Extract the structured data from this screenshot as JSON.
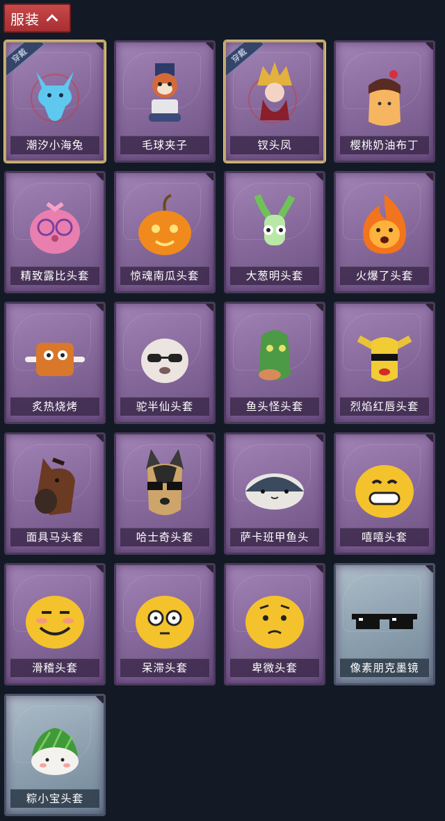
{
  "header": {
    "title": "服装"
  },
  "items": [
    {
      "name": "潮汐小海兔",
      "equipped": true,
      "equipped_label": "穿戴",
      "icon": "blue-bunny-icon"
    },
    {
      "name": "毛球夹子",
      "equipped": false,
      "icon": "raccoon-drummer-icon"
    },
    {
      "name": "钗头凤",
      "equipped": true,
      "equipped_label": "穿戴",
      "icon": "phoenix-headdress-icon"
    },
    {
      "name": "樱桃奶油布丁",
      "equipped": false,
      "icon": "pudding-icon"
    },
    {
      "name": "精致露比头套",
      "equipped": false,
      "icon": "pink-glasses-mask-icon"
    },
    {
      "name": "惊魂南瓜头套",
      "equipped": false,
      "icon": "pumpkin-icon"
    },
    {
      "name": "大葱明头套",
      "equipped": false,
      "icon": "scallion-mask-icon"
    },
    {
      "name": "火爆了头套",
      "equipped": false,
      "icon": "fire-mask-icon"
    },
    {
      "name": "炙热烧烤",
      "equipped": false,
      "icon": "bbq-meat-icon"
    },
    {
      "name": "驼半仙头套",
      "equipped": false,
      "icon": "alpaca-sunglasses-icon"
    },
    {
      "name": "鱼头怪头套",
      "equipped": false,
      "icon": "fish-head-icon"
    },
    {
      "name": "烈焰红唇头套",
      "equipped": false,
      "icon": "yellow-sunglasses-mask-icon"
    },
    {
      "name": "面具马头套",
      "equipped": false,
      "icon": "horse-mask-icon"
    },
    {
      "name": "哈士奇头套",
      "equipped": false,
      "icon": "husky-sunglasses-icon"
    },
    {
      "name": "萨卡班甲鱼头",
      "equipped": false,
      "icon": "sacabambaspis-icon"
    },
    {
      "name": "嘻嘻头套",
      "equipped": false,
      "icon": "grin-emoji-icon"
    },
    {
      "name": "滑稽头套",
      "equipped": false,
      "icon": "smirk-emoji-icon"
    },
    {
      "name": "呆滞头套",
      "equipped": false,
      "icon": "blank-stare-emoji-icon"
    },
    {
      "name": "卑微头套",
      "equipped": false,
      "icon": "humble-emoji-icon"
    },
    {
      "name": "像素朋克墨镜",
      "equipped": false,
      "rarity": "blue",
      "icon": "pixel-sunglasses-icon"
    },
    {
      "name": "粽小宝头套",
      "equipped": false,
      "rarity": "blue",
      "icon": "zongzi-mask-icon"
    }
  ],
  "colors": {
    "background": "#131a26",
    "header_button": "#b8393d",
    "card_purple": "#8f71a4",
    "card_blue": "#8ea1b0",
    "equipped_border": "#c2a768"
  }
}
